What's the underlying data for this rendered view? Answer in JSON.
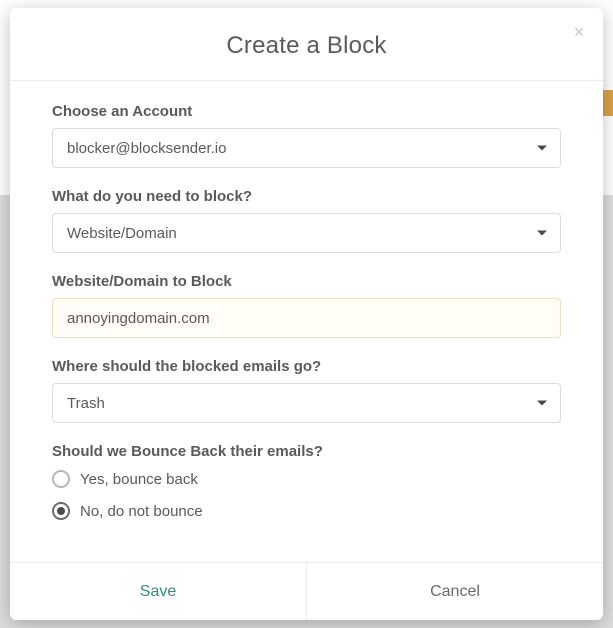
{
  "modal": {
    "title": "Create a Block",
    "close_label": "×"
  },
  "account": {
    "label": "Choose an Account",
    "value": "blocker@blocksender.io"
  },
  "block_type": {
    "label": "What do you need to block?",
    "value": "Website/Domain"
  },
  "target": {
    "label": "Website/Domain to Block",
    "value": "annoyingdomain.com"
  },
  "destination": {
    "label": "Where should the blocked emails go?",
    "value": "Trash"
  },
  "bounce": {
    "label": "Should we Bounce Back their emails?",
    "options": {
      "yes": "Yes, bounce back",
      "no": "No, do not bounce"
    },
    "selected": "no"
  },
  "footer": {
    "save": "Save",
    "cancel": "Cancel"
  }
}
